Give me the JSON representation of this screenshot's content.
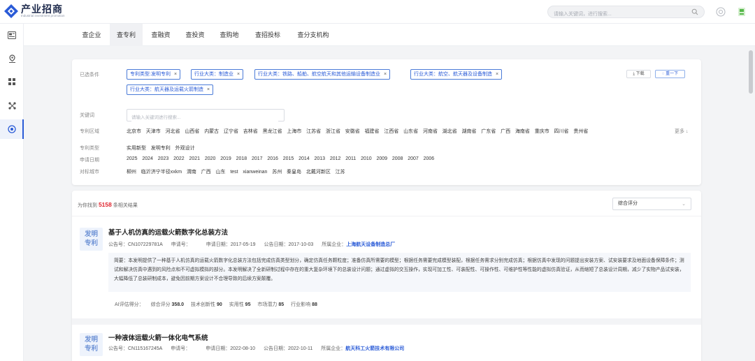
{
  "header": {
    "logo_title": "产业招商",
    "logo_subtitle": "Industrial investment promotion",
    "search_placeholder": "请输入关键词，进行搜索..."
  },
  "tabs": [
    "查企业",
    "查专利",
    "查融资",
    "查投资",
    "查购地",
    "查招投标",
    "查分支机构"
  ],
  "active_tab": "查专利",
  "filters": {
    "selected_label": "已选条件",
    "chips": [
      "专利类型:发明专利",
      "行业大类：制造业",
      "行业大类：铁路、船舶、航空航天和其他运输设备制造业",
      "行业大类：航空、航天器及设备制造",
      "行业大类：航天器及运载火箭制造"
    ],
    "download_label": "⤓ 下载",
    "reset_label": "◌ 重一下",
    "keyword_label": "关键词",
    "keyword_placeholder": "请输入关键词进行搜索...",
    "region_label": "专利区域",
    "regions": [
      "北京市",
      "天津市",
      "河北省",
      "山西省",
      "内蒙古",
      "辽宁省",
      "吉林省",
      "黑龙江省",
      "上海市",
      "江苏省",
      "浙江省",
      "安徽省",
      "福建省",
      "江西省",
      "山东省",
      "河南省",
      "湖北省",
      "湖南省",
      "广东省",
      "广西",
      "海南省",
      "重庆市",
      "四川省",
      "贵州省"
    ],
    "more_label": "更多 ↓",
    "type_label": "专利类型",
    "types": [
      "实用新型",
      "发明专利",
      "外观设计"
    ],
    "date_label": "申请日期",
    "years": [
      "2025",
      "2024",
      "2023",
      "2022",
      "2021",
      "2020",
      "2019",
      "2018",
      "2017",
      "2016",
      "2015",
      "2014",
      "2013",
      "2012",
      "2011",
      "2010",
      "2009",
      "2008",
      "2007",
      "2006"
    ],
    "city_label": "对标城市",
    "cities": [
      "柳州",
      "临沂济宁半径xxkm",
      "渭南",
      "广西",
      "山东",
      "test",
      "xianweinan",
      "苏州",
      "秦皇岛",
      "北戴河新区",
      "江苏"
    ]
  },
  "results": {
    "count_prefix": "为你找到",
    "count": "5158",
    "count_suffix": "条相关结果",
    "sort_value": "综合评分",
    "items": [
      {
        "badge_line1": "发明",
        "badge_line2": "专利",
        "title": "基于人机仿真的运载火箭数字化总装方法",
        "pub_no_label": "公告号：",
        "pub_no": "CN107229781A",
        "app_no_label": "申请号：",
        "app_no": "",
        "app_date_label": "申请日期：",
        "app_date": "2017-05-19",
        "pub_date_label": "公告日期：",
        "pub_date": "2017-10-03",
        "company_label": "所属企业：",
        "company": "上海航天设备制造总厂",
        "abstract": "简要：本发明提供了一种基于人机仿真的运载火箭数字化总装方法包括完成仿真类型划分，确定仿真任务颗粒度；准备仿真所需要的模型；根据任务需要完成模型装配，根据任务需求分别完成仿真；根据仿真中发现的问题提出安装方案、试安装要求及地面设备保障条件；测试和解决仿真中遇到的风险点和不可虚拟模拟的部分。本发明解决了全新研制过程中存在的重大复杂环境下的总装设计问题；通过虚拟的交互操作，实现可加工性、可装配性、可操作性、可维护性等性能的虚拟仿真验证，从而缩短了总装设计周期，减少了实物产品试安装，大幅降低了总装研制成本，避免因前期方案设计不合理导致的后续方案颠覆。",
        "score_label": "AI评估得分：",
        "scores": [
          {
            "label": "综合评分",
            "value": "358.0"
          },
          {
            "label": "技术创新性",
            "value": "90"
          },
          {
            "label": "实用性",
            "value": "95"
          },
          {
            "label": "市场潜力",
            "value": "85"
          },
          {
            "label": "行业影响",
            "value": "88"
          }
        ]
      },
      {
        "badge_line1": "发明",
        "badge_line2": "专利",
        "title": "一种液体运载火箭一体化电气系统",
        "pub_no_label": "公告号：",
        "pub_no": "CN115167245A",
        "app_no_label": "申请号：",
        "app_no": "",
        "app_date_label": "申请日期：",
        "app_date": "2022-08-10",
        "pub_date_label": "公告日期：",
        "pub_date": "2022-10-11",
        "company_label": "所属企业：",
        "company": "航天科工火箭技术有限公司"
      }
    ]
  },
  "colors": {
    "accent": "#2a5bd7",
    "count_red": "#e0262f",
    "badge_bg": "#eef3fc"
  }
}
